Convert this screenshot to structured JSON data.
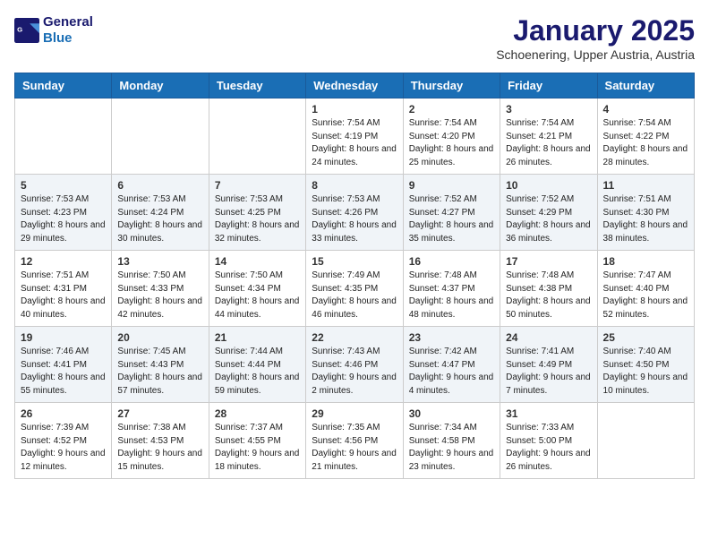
{
  "header": {
    "logo_line1": "General",
    "logo_line2": "Blue",
    "month": "January 2025",
    "location": "Schoenering, Upper Austria, Austria"
  },
  "weekdays": [
    "Sunday",
    "Monday",
    "Tuesday",
    "Wednesday",
    "Thursday",
    "Friday",
    "Saturday"
  ],
  "weeks": [
    [
      {
        "day": "",
        "info": ""
      },
      {
        "day": "",
        "info": ""
      },
      {
        "day": "",
        "info": ""
      },
      {
        "day": "1",
        "info": "Sunrise: 7:54 AM\nSunset: 4:19 PM\nDaylight: 8 hours and 24 minutes."
      },
      {
        "day": "2",
        "info": "Sunrise: 7:54 AM\nSunset: 4:20 PM\nDaylight: 8 hours and 25 minutes."
      },
      {
        "day": "3",
        "info": "Sunrise: 7:54 AM\nSunset: 4:21 PM\nDaylight: 8 hours and 26 minutes."
      },
      {
        "day": "4",
        "info": "Sunrise: 7:54 AM\nSunset: 4:22 PM\nDaylight: 8 hours and 28 minutes."
      }
    ],
    [
      {
        "day": "5",
        "info": "Sunrise: 7:53 AM\nSunset: 4:23 PM\nDaylight: 8 hours and 29 minutes."
      },
      {
        "day": "6",
        "info": "Sunrise: 7:53 AM\nSunset: 4:24 PM\nDaylight: 8 hours and 30 minutes."
      },
      {
        "day": "7",
        "info": "Sunrise: 7:53 AM\nSunset: 4:25 PM\nDaylight: 8 hours and 32 minutes."
      },
      {
        "day": "8",
        "info": "Sunrise: 7:53 AM\nSunset: 4:26 PM\nDaylight: 8 hours and 33 minutes."
      },
      {
        "day": "9",
        "info": "Sunrise: 7:52 AM\nSunset: 4:27 PM\nDaylight: 8 hours and 35 minutes."
      },
      {
        "day": "10",
        "info": "Sunrise: 7:52 AM\nSunset: 4:29 PM\nDaylight: 8 hours and 36 minutes."
      },
      {
        "day": "11",
        "info": "Sunrise: 7:51 AM\nSunset: 4:30 PM\nDaylight: 8 hours and 38 minutes."
      }
    ],
    [
      {
        "day": "12",
        "info": "Sunrise: 7:51 AM\nSunset: 4:31 PM\nDaylight: 8 hours and 40 minutes."
      },
      {
        "day": "13",
        "info": "Sunrise: 7:50 AM\nSunset: 4:33 PM\nDaylight: 8 hours and 42 minutes."
      },
      {
        "day": "14",
        "info": "Sunrise: 7:50 AM\nSunset: 4:34 PM\nDaylight: 8 hours and 44 minutes."
      },
      {
        "day": "15",
        "info": "Sunrise: 7:49 AM\nSunset: 4:35 PM\nDaylight: 8 hours and 46 minutes."
      },
      {
        "day": "16",
        "info": "Sunrise: 7:48 AM\nSunset: 4:37 PM\nDaylight: 8 hours and 48 minutes."
      },
      {
        "day": "17",
        "info": "Sunrise: 7:48 AM\nSunset: 4:38 PM\nDaylight: 8 hours and 50 minutes."
      },
      {
        "day": "18",
        "info": "Sunrise: 7:47 AM\nSunset: 4:40 PM\nDaylight: 8 hours and 52 minutes."
      }
    ],
    [
      {
        "day": "19",
        "info": "Sunrise: 7:46 AM\nSunset: 4:41 PM\nDaylight: 8 hours and 55 minutes."
      },
      {
        "day": "20",
        "info": "Sunrise: 7:45 AM\nSunset: 4:43 PM\nDaylight: 8 hours and 57 minutes."
      },
      {
        "day": "21",
        "info": "Sunrise: 7:44 AM\nSunset: 4:44 PM\nDaylight: 8 hours and 59 minutes."
      },
      {
        "day": "22",
        "info": "Sunrise: 7:43 AM\nSunset: 4:46 PM\nDaylight: 9 hours and 2 minutes."
      },
      {
        "day": "23",
        "info": "Sunrise: 7:42 AM\nSunset: 4:47 PM\nDaylight: 9 hours and 4 minutes."
      },
      {
        "day": "24",
        "info": "Sunrise: 7:41 AM\nSunset: 4:49 PM\nDaylight: 9 hours and 7 minutes."
      },
      {
        "day": "25",
        "info": "Sunrise: 7:40 AM\nSunset: 4:50 PM\nDaylight: 9 hours and 10 minutes."
      }
    ],
    [
      {
        "day": "26",
        "info": "Sunrise: 7:39 AM\nSunset: 4:52 PM\nDaylight: 9 hours and 12 minutes."
      },
      {
        "day": "27",
        "info": "Sunrise: 7:38 AM\nSunset: 4:53 PM\nDaylight: 9 hours and 15 minutes."
      },
      {
        "day": "28",
        "info": "Sunrise: 7:37 AM\nSunset: 4:55 PM\nDaylight: 9 hours and 18 minutes."
      },
      {
        "day": "29",
        "info": "Sunrise: 7:35 AM\nSunset: 4:56 PM\nDaylight: 9 hours and 21 minutes."
      },
      {
        "day": "30",
        "info": "Sunrise: 7:34 AM\nSunset: 4:58 PM\nDaylight: 9 hours and 23 minutes."
      },
      {
        "day": "31",
        "info": "Sunrise: 7:33 AM\nSunset: 5:00 PM\nDaylight: 9 hours and 26 minutes."
      },
      {
        "day": "",
        "info": ""
      }
    ]
  ]
}
